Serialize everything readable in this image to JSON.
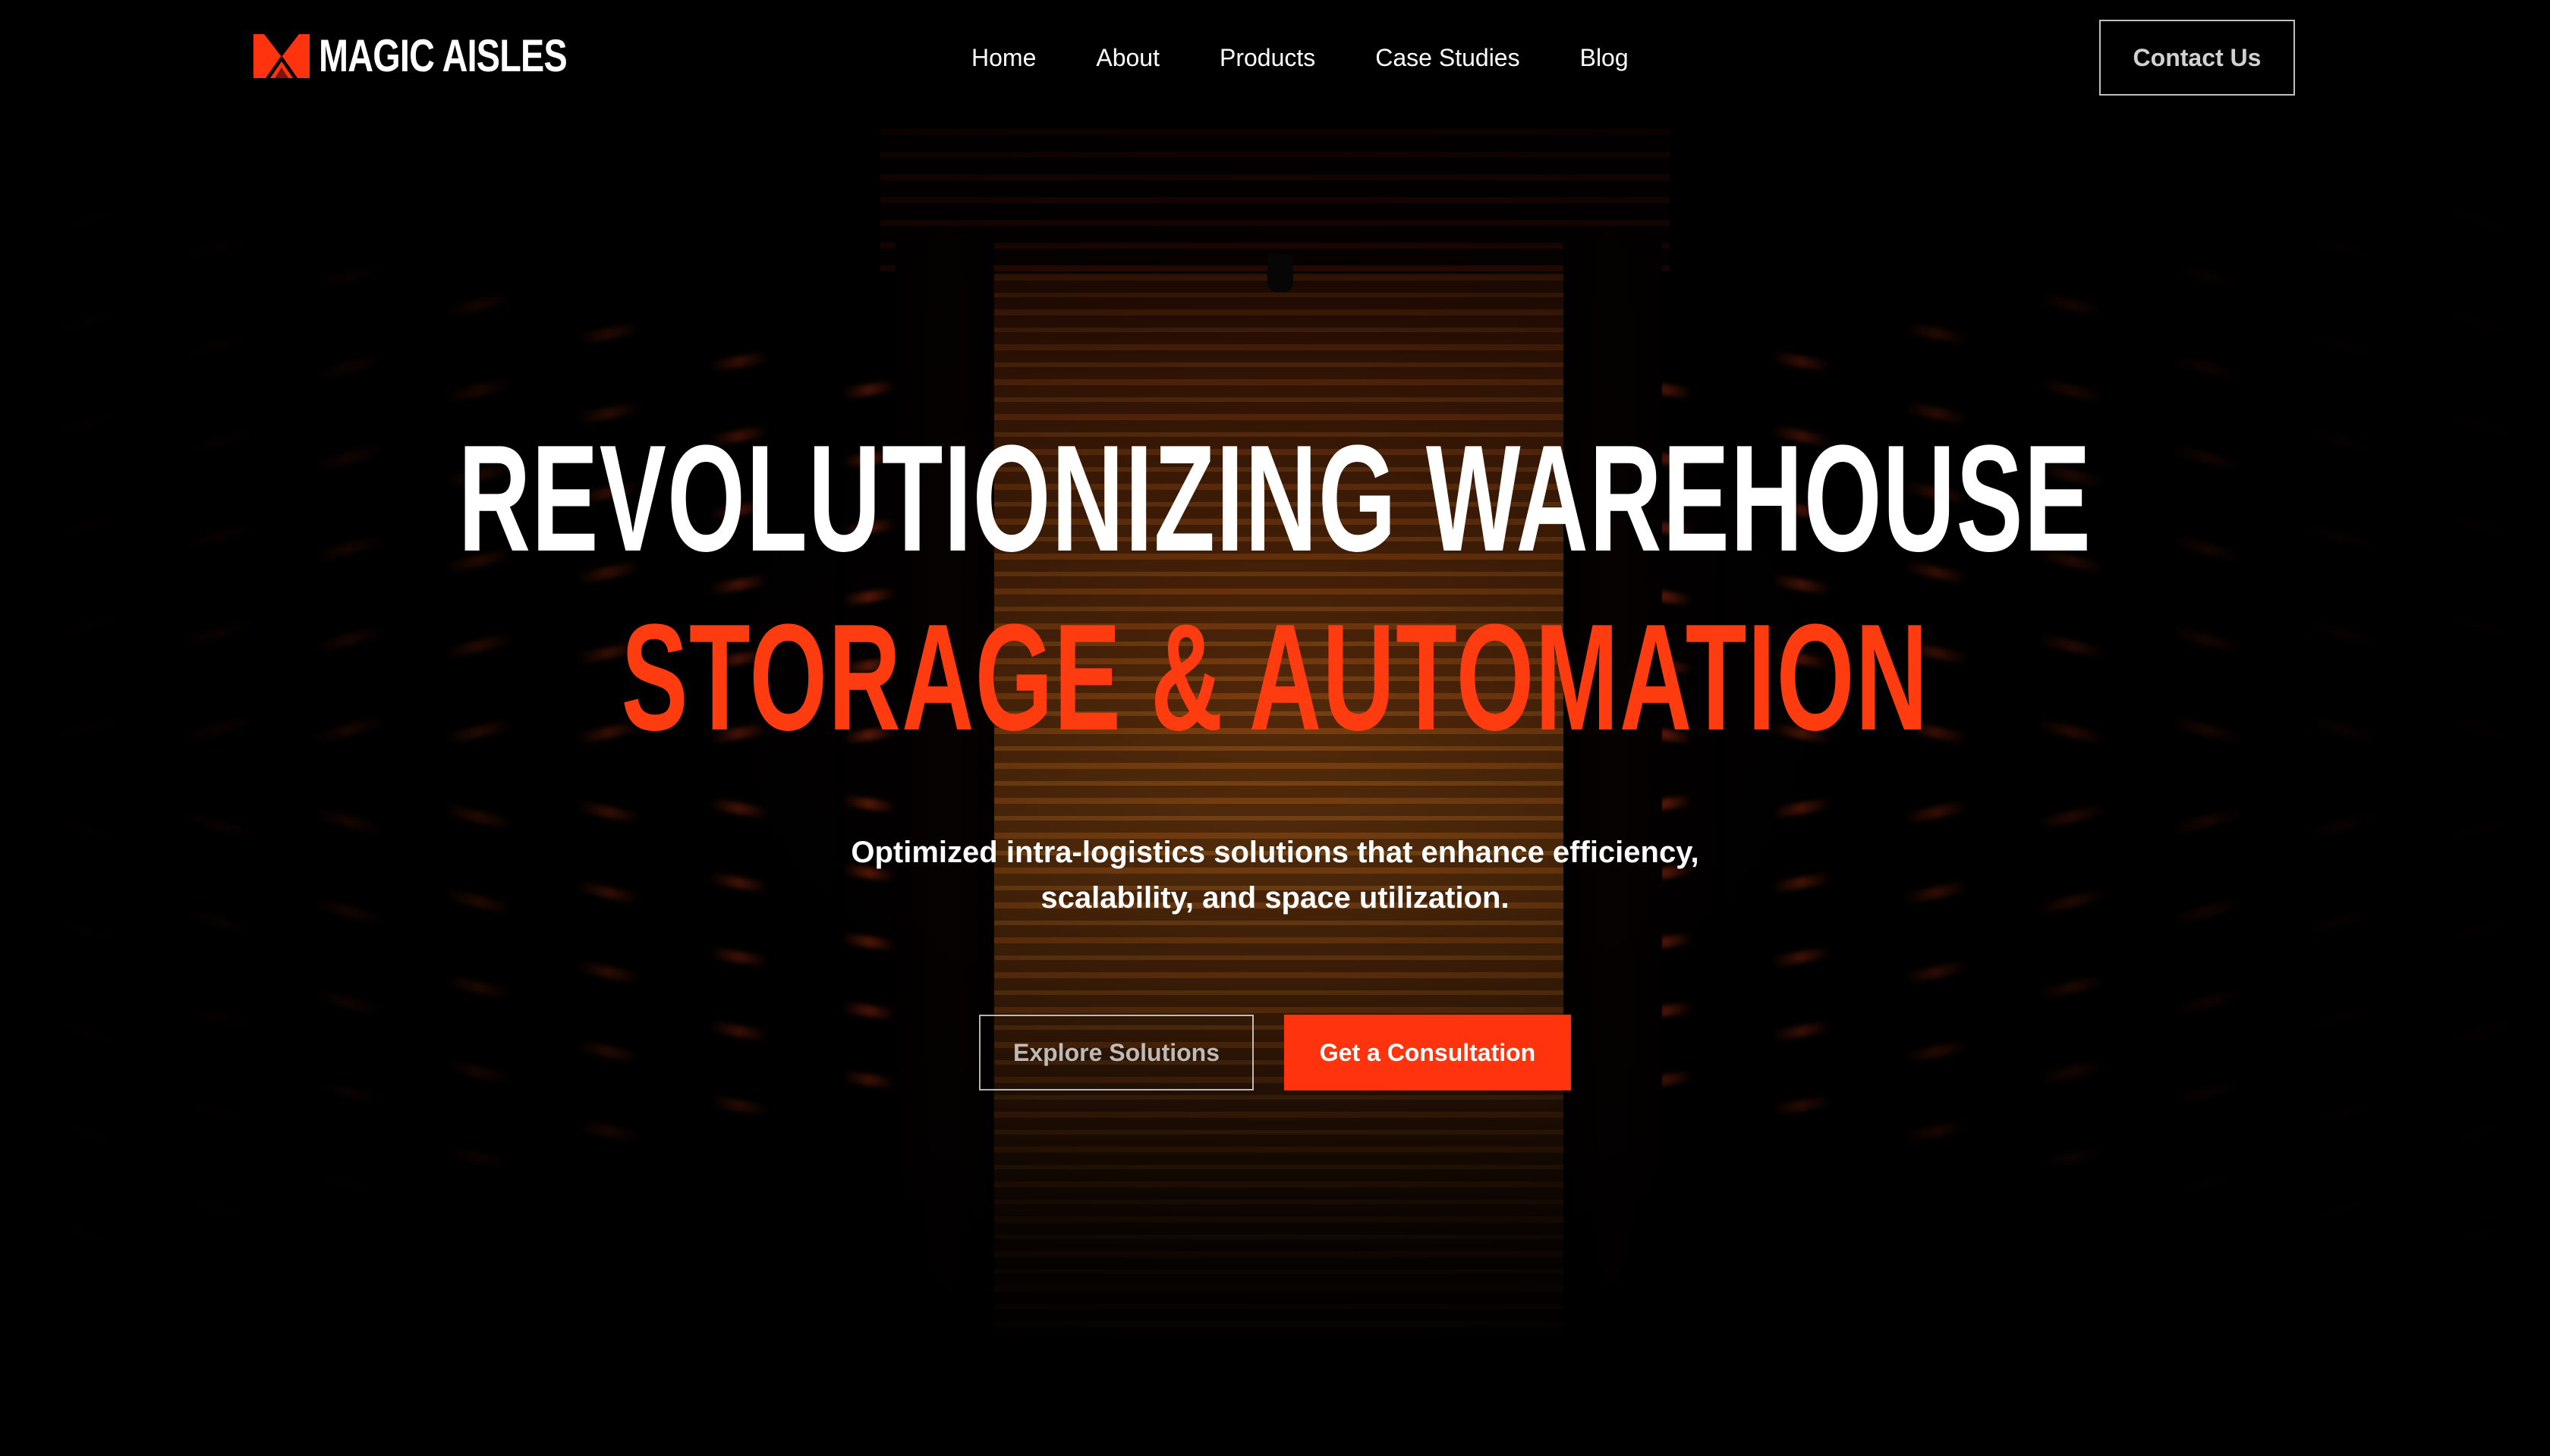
{
  "brand": {
    "name": "MAGIC AISLES",
    "logo_icon": "magic-aisles-logo-mark",
    "accent_color": "#ff330d"
  },
  "nav": {
    "items": [
      {
        "label": "Home"
      },
      {
        "label": "About"
      },
      {
        "label": "Products"
      },
      {
        "label": "Case Studies"
      },
      {
        "label": "Blog"
      }
    ],
    "contact_label": "Contact Us"
  },
  "hero": {
    "headline_line1": "REVOLUTIONIZING WAREHOUSE",
    "headline_line2": "STORAGE & AUTOMATION",
    "subheadline": "Optimized intra-logistics solutions that enhance efficiency, scalability, and space utilization.",
    "primary_cta": "Get a Consultation",
    "secondary_cta": "Explore Solutions",
    "background_image": "warehouse-aisle-photo"
  }
}
